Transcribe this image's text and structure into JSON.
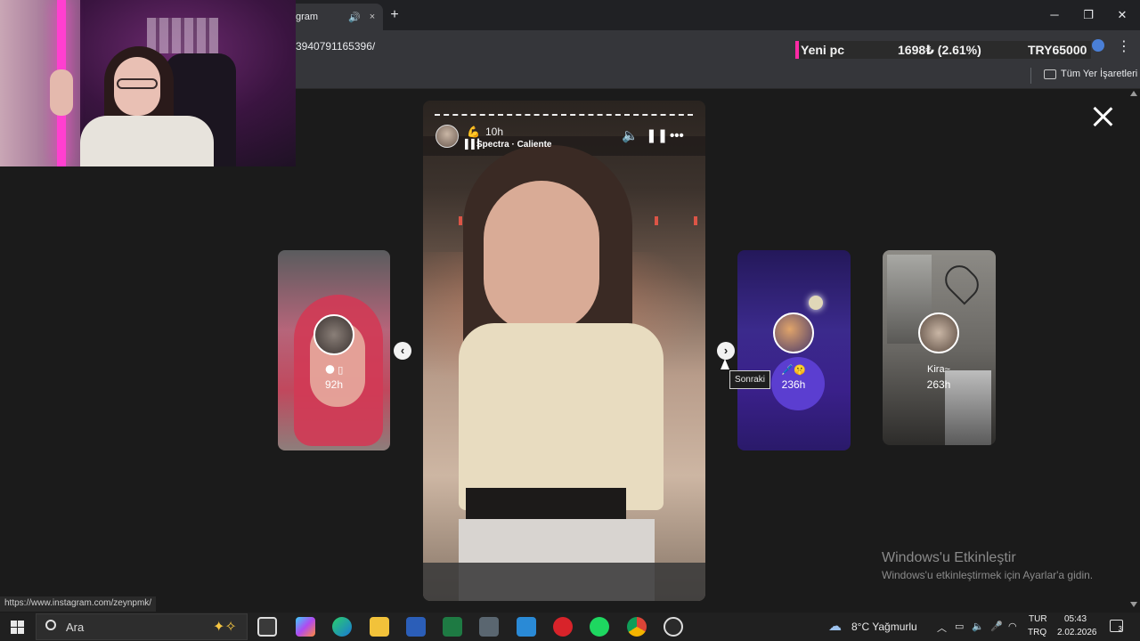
{
  "browser": {
    "tab_title": "gram",
    "url": "3940791165396/",
    "bookmark_folder": "Tüm Yer İşaretleri",
    "tab_audio_icon": "speaker-icon",
    "tab_close": "×",
    "new_tab": "+"
  },
  "ticker": {
    "label": "Yeni pc",
    "amount": "1698₺ (2.61%)",
    "goal": "TRY65000"
  },
  "story": {
    "time": "10h",
    "emoji": "💪",
    "music": "Spectra · Caliente",
    "eq_icon": "▌▌▎",
    "menu": "•••"
  },
  "cards": [
    {
      "name": "🌑 ▯",
      "time": "92h"
    },
    {
      "name": "🖊️🤫",
      "time": "236h"
    },
    {
      "name": "Kira~",
      "time": "263h"
    }
  ],
  "tooltip": "Sonraki",
  "activation": {
    "title": "Windows'u Etkinleştir",
    "subtitle": "Windows'u etkinleştirmek için Ayarlar'a gidin."
  },
  "status_url": "https://www.instagram.com/zeynpmk/",
  "taskbar": {
    "search_text": "Ara",
    "weather": "8°C  Yağmurlu",
    "lang_top": "TUR",
    "lang_bottom": "TRQ",
    "time": "05:43",
    "date": "2.02.2026",
    "notif_count": "3"
  },
  "colors": {
    "accent_pink": "#ff2aa5",
    "chrome_dark": "#202124",
    "chrome_mid": "#35363a"
  }
}
